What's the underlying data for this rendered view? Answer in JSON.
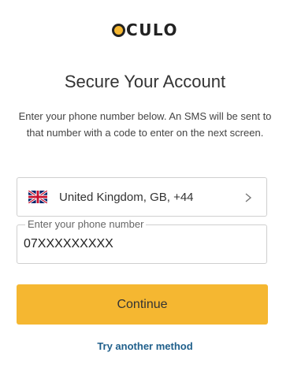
{
  "logo": {
    "first_letter": "O",
    "rest": "CULO",
    "colors": {
      "ring": "#222222",
      "center": "#f5b731"
    }
  },
  "heading": "Secure Your Account",
  "description": "Enter your phone number below. An SMS will be sent to that number with a code to enter on the next screen.",
  "country_select": {
    "flag_icon": "uk-flag-icon",
    "value": "United Kingdom, GB, +44",
    "chevron_icon": "chevron-right-icon"
  },
  "phone_field": {
    "label": "Enter your phone number",
    "value": "07XXXXXXXXX"
  },
  "continue_button": {
    "label": "Continue",
    "color": "#f5b731"
  },
  "alternate_link": {
    "label": "Try another method",
    "color": "#1f5f8b"
  }
}
